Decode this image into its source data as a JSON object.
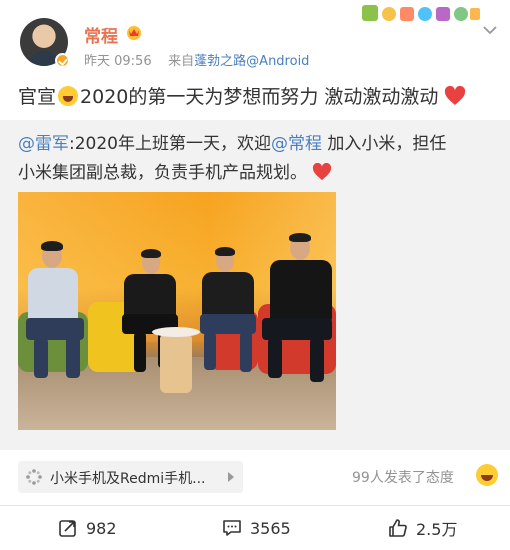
{
  "header": {
    "username": "常程",
    "time": "昨天 09:56",
    "source_prefix": "来自",
    "source": "蓬勃之路@Android"
  },
  "post": {
    "text_before_emoji": "官宣",
    "text_after_emoji": "2020的第一天为梦想而努力  激动激动激动"
  },
  "repost": {
    "author_mention": "@雷军",
    "line1_a": ":2020年上班第一天，欢迎",
    "line1_mention": "@常程",
    "line1_b": " 加入小米，担任",
    "line2": "小米集团副总裁，负责手机产品规划。",
    "photo_alt": "Four men seated in an orange office lounge"
  },
  "footer": {
    "topic_label": "小米手机及Redmi手机...",
    "attitude_text": "99人发表了态度"
  },
  "actions": {
    "repost_count": "982",
    "comment_count": "3565",
    "like_count": "2.5万"
  },
  "colors": {
    "accent_name": "#eb7350",
    "link": "#4a7fc1",
    "heart": "#e8413f"
  }
}
